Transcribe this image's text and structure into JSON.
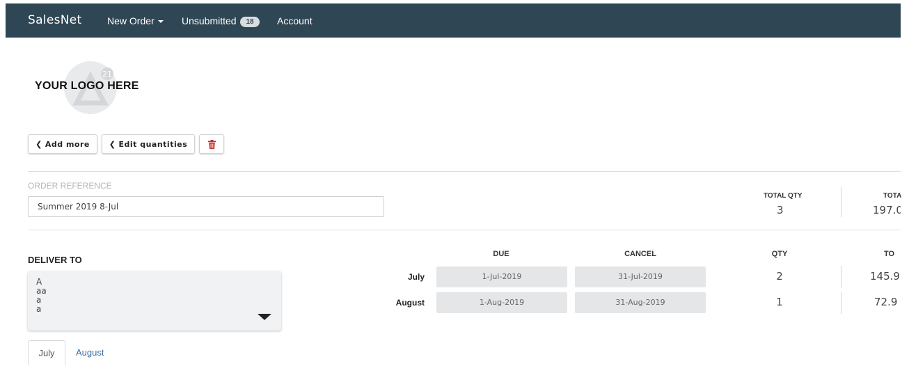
{
  "nav": {
    "brand": "SalesNet",
    "new_order": "New Order",
    "unsubmitted": "Unsubmitted",
    "unsubmitted_count": "18",
    "account": "Account"
  },
  "logo": {
    "text": "YOUR LOGO HERE",
    "badge": "21"
  },
  "toolbar": {
    "add_more": "Add more",
    "edit_quantities": "Edit quantities",
    "delete_icon": "trash-icon"
  },
  "order": {
    "reference_label": "ORDER REFERENCE",
    "reference_value": "Summer 2019 8-Jul"
  },
  "summary": {
    "total_qty_label": "TOTAL QTY",
    "total_qty": "3",
    "total_label": "TOTA",
    "total_value": "197.0"
  },
  "deliver": {
    "label": "DELIVER TO",
    "lines": [
      "A",
      "aa",
      "a",
      "a"
    ]
  },
  "schedule": {
    "headers": {
      "due": "DUE",
      "cancel": "CANCEL",
      "qty": "QTY",
      "total": "TO"
    },
    "rows": [
      {
        "month": "July",
        "due": "1-Jul-2019",
        "cancel": "31-Jul-2019",
        "qty": "2",
        "total": "145.9"
      },
      {
        "month": "August",
        "due": "1-Aug-2019",
        "cancel": "31-Aug-2019",
        "qty": "1",
        "total": "72.9"
      }
    ]
  },
  "tabs": [
    "July",
    "August"
  ],
  "colors": {
    "navbar": "#2f4654",
    "link": "#3a6ea5",
    "danger": "#c9302c"
  }
}
